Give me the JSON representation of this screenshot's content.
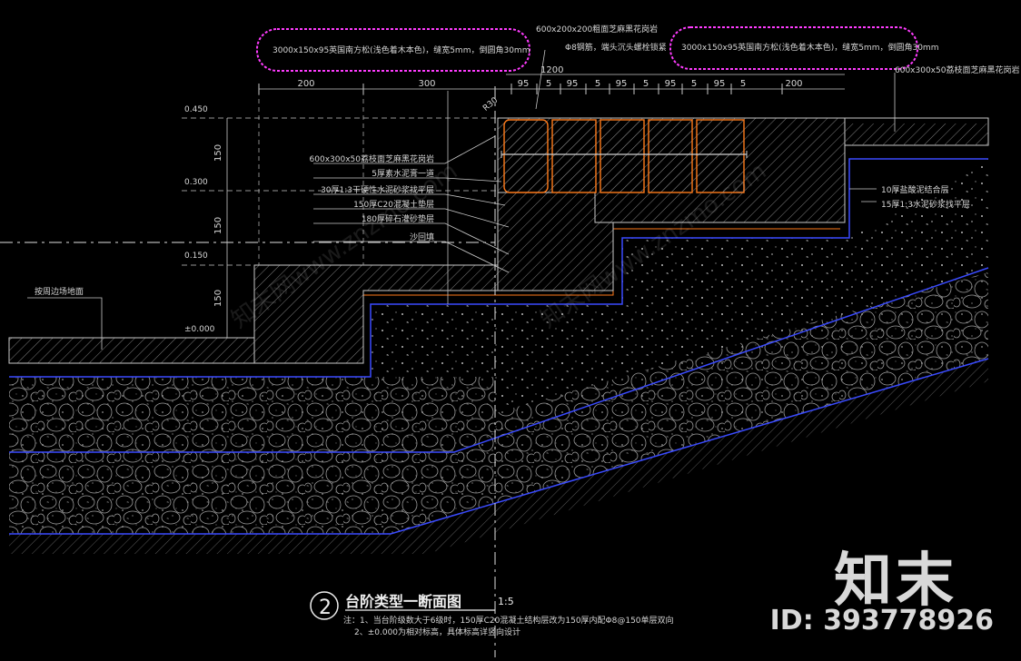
{
  "title": {
    "number": "2",
    "text": "台阶类型一断面图",
    "scale": "1:5"
  },
  "notes": [
    "注：1、当台阶级数大于6级时，150厚C20混凝土结构层改为150厚内配Φ8@150单层双向",
    "2、±0.000为相对标高，具体标高详竖向设计"
  ],
  "callouts": {
    "cloud_left": "3000x150x95英国南方松(浅色着木本色)，缝宽5mm，倒圆角30mm",
    "cloud_right": "3000x150x95英国南方松(浅色着木本色)，缝宽5mm，倒圆角30mm",
    "top_center_1": "600x200x200粗面芝麻黑花岗岩",
    "top_center_2": "Φ8钢筋，端头沉头螺栓锁紧",
    "top_right": "600x300x50荔枝面芝麻黑花岗岩",
    "radius": "R30",
    "ground_left": "按周边场地面",
    "right_1": "10厚盐酸泥结合层",
    "right_2": "15厚1:3水泥砂浆找平层"
  },
  "layers_left": [
    "600x300x50荔枝面芝麻黑花岗岩",
    "5厚素水泥膏一道",
    "30厚1:3干硬性水泥砂浆找平层",
    "150厚C20混凝土垫层",
    "180厚碎石灌砂垫层",
    "沙回填"
  ],
  "elevations": [
    "0.450",
    "0.300",
    "0.150",
    "±0.000"
  ],
  "dimensions": {
    "top_total": "1200",
    "top_row": [
      "200",
      "300",
      "95",
      "5",
      "95",
      "5",
      "95",
      "5",
      "95",
      "5",
      "95",
      "5",
      "200"
    ],
    "vertical": [
      "150",
      "150",
      "150"
    ]
  },
  "watermark": {
    "logo": "知末",
    "id": "ID: 393778926",
    "faint": "知末网www.znzmo.com"
  },
  "colors": {
    "background": "#000000",
    "line": "#c8c8c8",
    "wood": "#ff7a1a",
    "cloud": "#ff3cff",
    "blue": "#3a4bff",
    "hatch": "#8a8a8a"
  }
}
